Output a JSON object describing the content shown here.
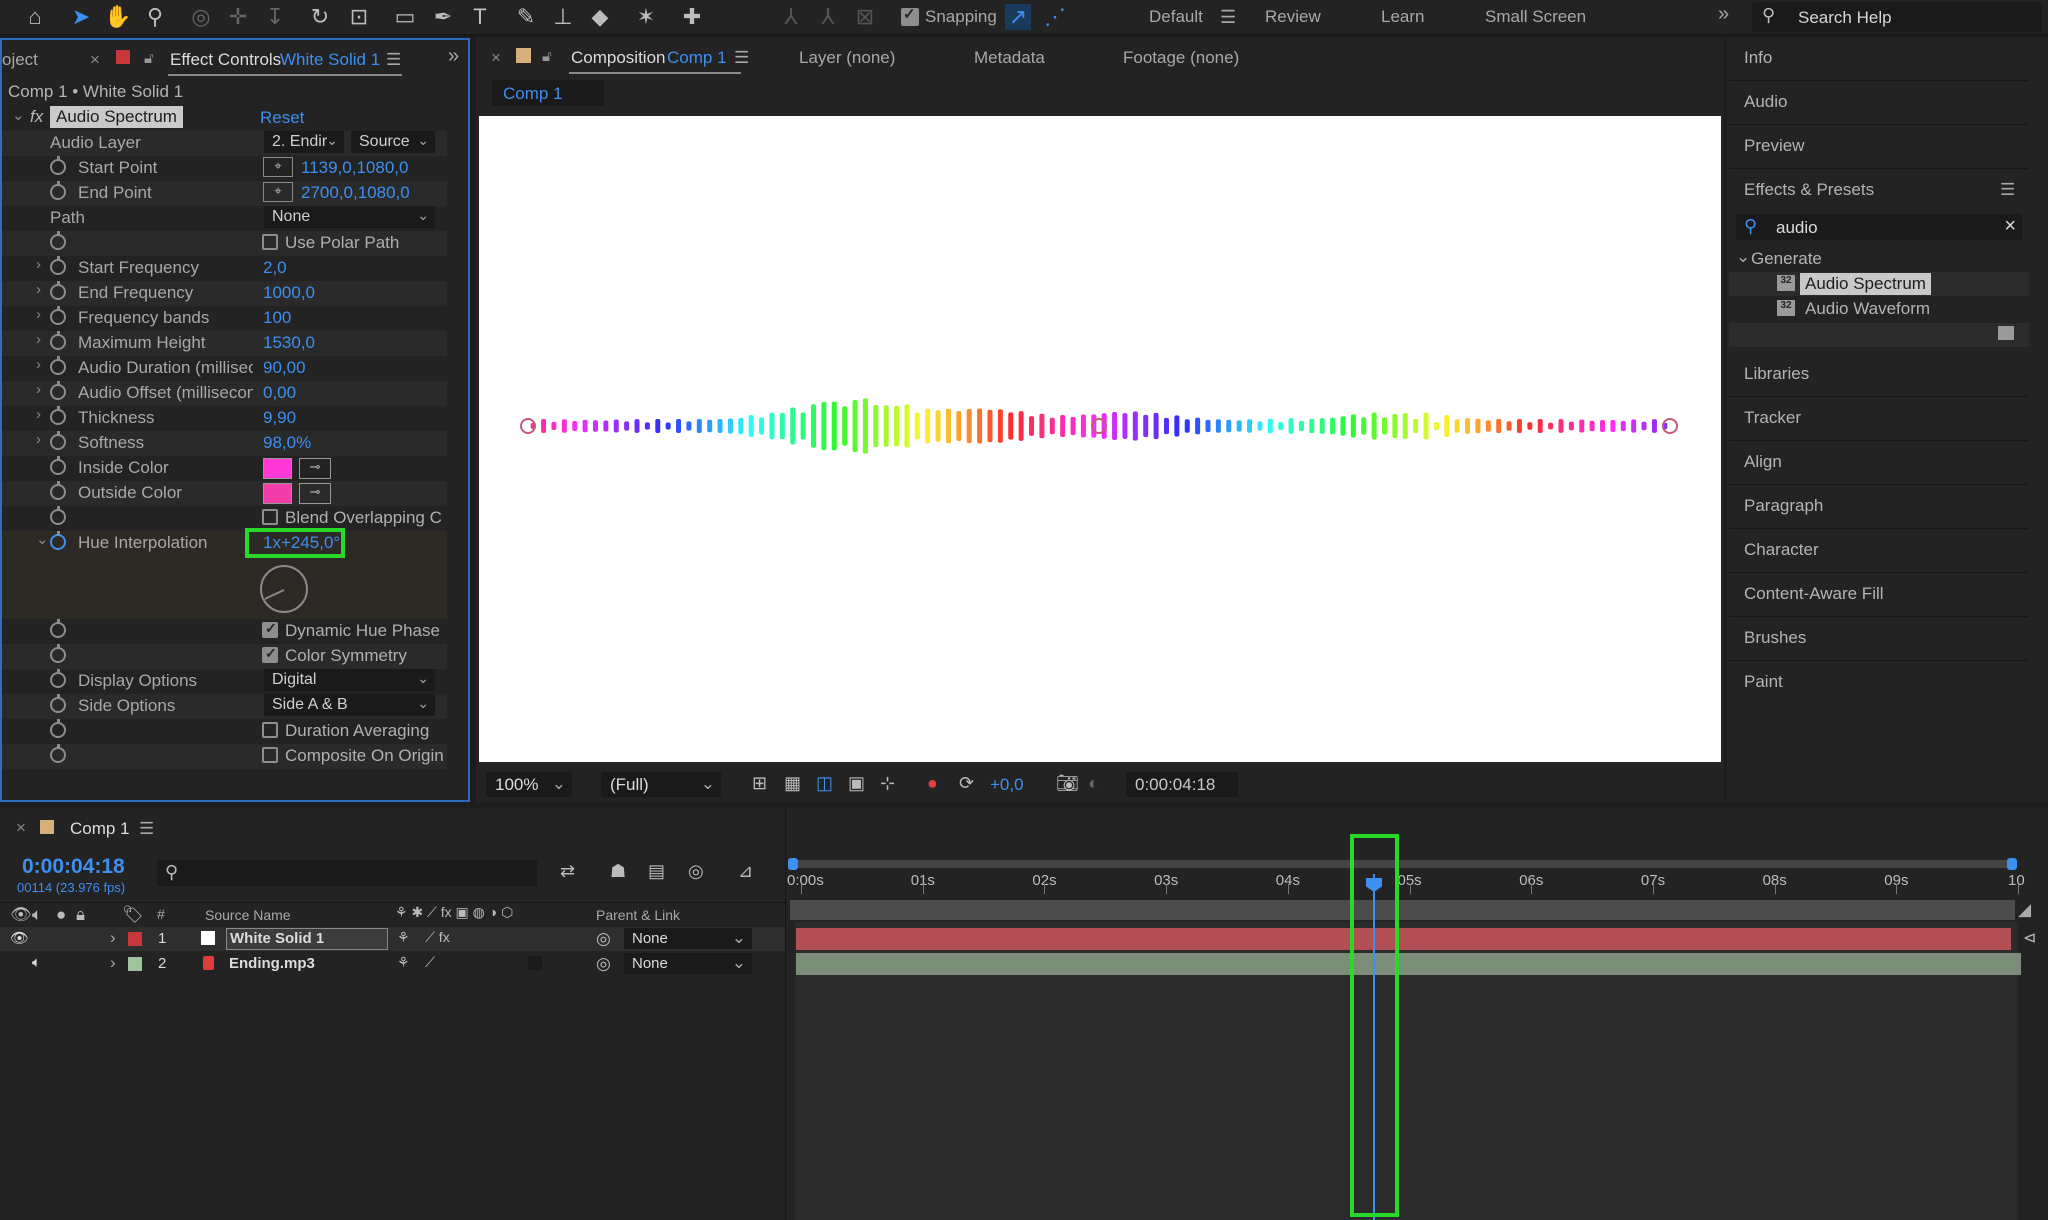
{
  "toolbar": {
    "snapping_label": "Snapping",
    "workspaces": [
      "Default",
      "Review",
      "Learn",
      "Small Screen"
    ],
    "search_placeholder": "Search Help"
  },
  "effect_controls": {
    "tab_project": "oject",
    "tab_label": "Effect Controls",
    "tab_layer": "White Solid 1",
    "breadcrumb": "Comp 1 • White Solid 1",
    "effect_name": "Audio Spectrum",
    "reset": "Reset",
    "audio_layer": {
      "label": "Audio Layer",
      "value": "2. Endir",
      "source": "Source"
    },
    "start_point": {
      "label": "Start Point",
      "value": "1139,0,1080,0"
    },
    "end_point": {
      "label": "End Point",
      "value": "2700,0,1080,0"
    },
    "path": {
      "label": "Path",
      "value": "None"
    },
    "use_polar_path": "Use Polar Path",
    "start_frequency": {
      "label": "Start Frequency",
      "value": "2,0"
    },
    "end_frequency": {
      "label": "End Frequency",
      "value": "1000,0"
    },
    "frequency_bands": {
      "label": "Frequency bands",
      "value": "100"
    },
    "maximum_height": {
      "label": "Maximum Height",
      "value": "1530,0"
    },
    "audio_duration": {
      "label": "Audio Duration (millisec",
      "value": "90,00"
    },
    "audio_offset": {
      "label": "Audio Offset (millisecon",
      "value": "0,00"
    },
    "thickness": {
      "label": "Thickness",
      "value": "9,90"
    },
    "softness": {
      "label": "Softness",
      "value": "98,0%"
    },
    "inside_color": {
      "label": "Inside Color",
      "color": "#ff38d6"
    },
    "outside_color": {
      "label": "Outside Color",
      "color": "#f23ca8"
    },
    "blend_overlapping": "Blend Overlapping C",
    "hue_interpolation": {
      "label": "Hue Interpolation",
      "value": "1x+245,0°"
    },
    "dynamic_hue_phase": "Dynamic Hue Phase",
    "color_symmetry": "Color Symmetry",
    "display_options": {
      "label": "Display Options",
      "value": "Digital"
    },
    "side_options": {
      "label": "Side Options",
      "value": "Side A & B"
    },
    "duration_averaging": "Duration Averaging",
    "composite_on_origin": "Composite On Origin"
  },
  "composition": {
    "tab_label": "Composition",
    "tab_comp": "Comp 1",
    "other_tabs": [
      "Layer (none)",
      "Metadata",
      "Footage (none)"
    ],
    "comp_tab": "Comp 1",
    "zoom": "100%",
    "resolution": "(Full)",
    "exposure": "+0,0",
    "timecode": "0:00:04:18"
  },
  "right_panel": {
    "items_top": [
      "Info",
      "Audio",
      "Preview"
    ],
    "effects_presets": "Effects & Presets",
    "search_value": "audio",
    "category": "Generate",
    "results": [
      "Audio Spectrum",
      "Audio Waveform"
    ],
    "items_bottom": [
      "Libraries",
      "Tracker",
      "Align",
      "Paragraph",
      "Character",
      "Content-Aware Fill",
      "Brushes",
      "Paint"
    ]
  },
  "timeline": {
    "tab": "Comp 1",
    "timecode": "0:00:04:18",
    "fps": "00114 (23.976 fps)",
    "col_hash": "#",
    "col_source": "Source Name",
    "col_parent": "Parent & Link",
    "ruler": [
      "0:00s",
      "01s",
      "02s",
      "03s",
      "04s",
      "05s",
      "06s",
      "07s",
      "08s",
      "09s",
      "10"
    ],
    "layers": [
      {
        "num": "1",
        "name": "White Solid 1",
        "parent": "None",
        "label_color": "#c8373a"
      },
      {
        "num": "2",
        "name": "Ending.mp3",
        "parent": "None",
        "label_color": "#9fc39b"
      }
    ]
  },
  "colors": {
    "accent": "#3d8ff0",
    "highlight": "#29d92a",
    "layer1_bar": "#b24f55",
    "layer2_bar": "#7b8c79"
  }
}
